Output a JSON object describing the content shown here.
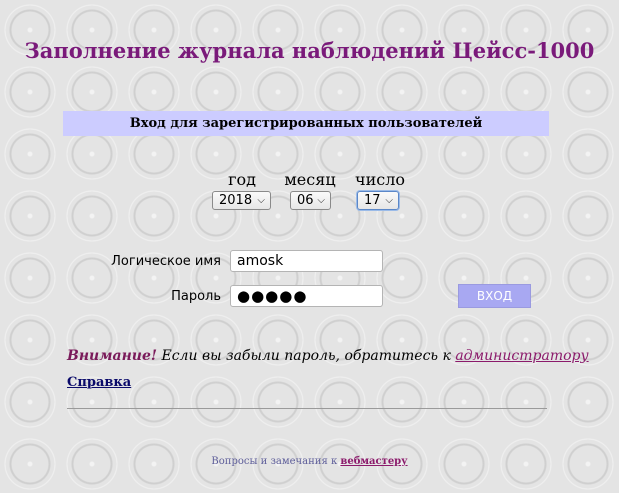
{
  "page": {
    "title": "Заполнение журнала наблюдений Цейсс-1000",
    "login_banner": "Вход для зарегистрированных пользователей"
  },
  "date": {
    "year_label": "год",
    "month_label": "месяц",
    "day_label": "число",
    "year_value": "2018",
    "month_value": "06",
    "day_value": "17"
  },
  "form": {
    "username_label": "Логическое имя",
    "username_value": "amosk",
    "password_label": "Пароль",
    "password_mask": "●●●●●",
    "login_button": "ВХОД"
  },
  "notice": {
    "strong": "Внимание!",
    "text": " Если вы забыли пароль, обратитесь к ",
    "admin_link": "администратору"
  },
  "help_link": "Справка",
  "footer": {
    "text": "Вопросы и замечания к ",
    "webmaster_link": "вебмастеру"
  },
  "colors": {
    "title": "#7a1a7a",
    "banner_bg": "#ccccff",
    "button_bg": "#a8a8f2",
    "link": "#8b1a6b"
  }
}
